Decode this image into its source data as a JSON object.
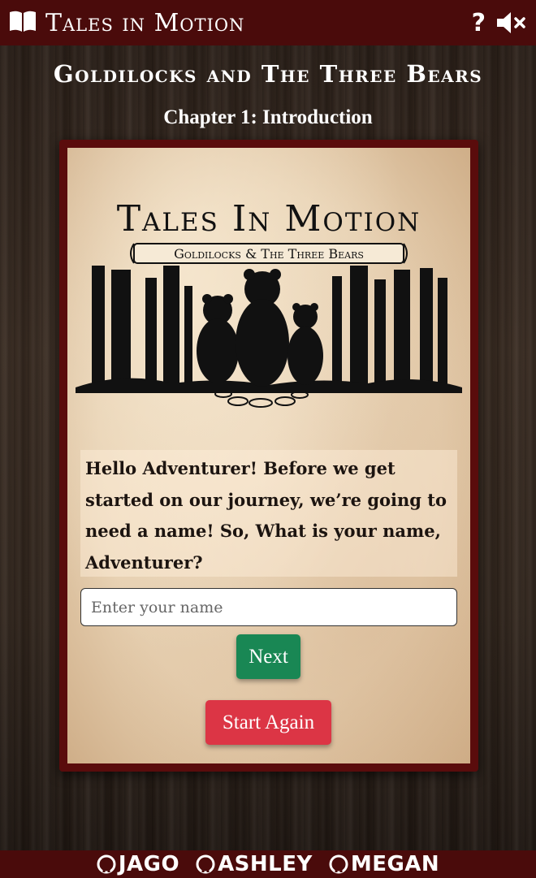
{
  "navbar": {
    "brand_title": "Tales in Motion",
    "brand_icon": "open-book-icon",
    "help_label": "?",
    "help_icon": "question-icon",
    "mute_icon": "volume-mute-icon"
  },
  "story": {
    "title": "Goldilocks and The Three Bears",
    "chapter": "Chapter 1: Introduction"
  },
  "cover": {
    "logo_title": "Tales In Motion",
    "logo_subtitle": "Goldilocks & The Three Bears"
  },
  "prompt": {
    "text": "Hello Adventurer! Before we get started on our journey, we’re going to need a name! So, What is your name, Adventurer?"
  },
  "name_input": {
    "value": "",
    "placeholder": "Enter your name"
  },
  "buttons": {
    "next": "Next",
    "start_again": "Start Again"
  },
  "footer": {
    "credits": [
      {
        "name": "JAGO",
        "icon": "github-icon"
      },
      {
        "name": "ASHLEY",
        "icon": "github-icon"
      },
      {
        "name": "MEGAN",
        "icon": "github-icon"
      }
    ]
  },
  "colors": {
    "navbar_bg": "#4a0b0b",
    "frame_bg": "#5a0c0c",
    "next_button": "#198754",
    "start_again_button": "#dc3545",
    "parchment": "#e6cfb0"
  }
}
